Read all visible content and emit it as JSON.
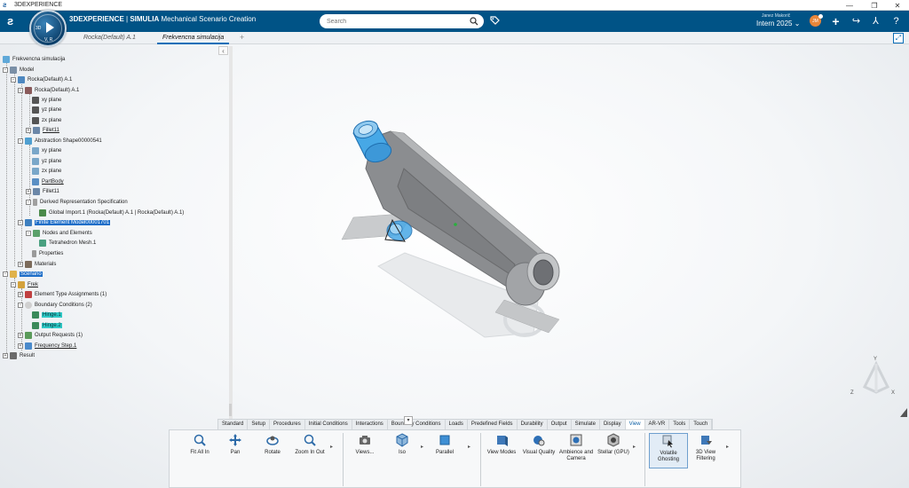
{
  "window": {
    "title": "3DEXPERIENCE",
    "controls": [
      "—",
      "❐",
      "✕"
    ]
  },
  "header": {
    "brand_bold": "3DEXPERIENCE",
    "brand_sep": " | ",
    "brand_product": "SIMULIA",
    "brand_app": " Mechanical Scenario Creation",
    "search_placeholder": "Search",
    "user_name": "Janez Makorič",
    "user_company": "Intern 2025",
    "avatar_initials": "JM",
    "icons": [
      "plus-icon",
      "share-icon",
      "collaborate-icon",
      "help-icon"
    ]
  },
  "compass": {
    "label_3d": "3D",
    "label_v": "V, R"
  },
  "tabs": [
    {
      "label": "Rocka(Default) A.1",
      "active": false
    },
    {
      "label": "Frekvencna simulacija",
      "active": true
    }
  ],
  "tab_add": "+",
  "tree": {
    "root": "Frekvencna simulacija",
    "model": "Model",
    "rocka_default": "Rocka(Default) A.1",
    "rocka_inner": "Rocka(Default) A.1",
    "xy1": "xy plane",
    "yz1": "yz plane",
    "zx1": "zx plane",
    "fillet1": "Fillet11",
    "abstraction": "Abstraction Shape00000541",
    "xy2": "xy plane",
    "yz2": "yz plane",
    "zx2": "zx plane",
    "partbody": "PartBody",
    "fillet2": "Fillet11",
    "derived": "Derived Representation Specification",
    "global_import": "Global Import.1 (Rocka(Default) A.1 | Rocka(Default) A.1)",
    "fem": "Finite Element Model00001701",
    "nodes": "Nodes and Elements",
    "tetra": "Tetrahedron Mesh.1",
    "properties": "Properties",
    "materials": "Materials",
    "scenario": "Scenario",
    "frek": "Frek",
    "eta": "Element Type Assignments (1)",
    "bc": "Boundary Conditions (2)",
    "hinge1": "Hinge.1",
    "hinge2": "Hinge.2",
    "output": "Output Requests (1)",
    "freqstep": "Frequency Step.1",
    "result": "Result"
  },
  "action_tabs": [
    {
      "label": "Standard"
    },
    {
      "label": "Setup"
    },
    {
      "label": "Procedures"
    },
    {
      "label": "Initial Conditions"
    },
    {
      "label": "Interactions"
    },
    {
      "label": "Boundary Conditions"
    },
    {
      "label": "Loads"
    },
    {
      "label": "Predefined Fields"
    },
    {
      "label": "Durability"
    },
    {
      "label": "Output"
    },
    {
      "label": "Simulate"
    },
    {
      "label": "Display"
    },
    {
      "label": "View",
      "active": true
    },
    {
      "label": "AR-VR"
    },
    {
      "label": "Tools"
    },
    {
      "label": "Touch"
    }
  ],
  "actions": {
    "fit": "Fit All In",
    "pan": "Pan",
    "rotate": "Rotate",
    "zoom": "Zoom In Out",
    "views": "Views...",
    "iso": "Iso",
    "parallel": "Parallel",
    "view_modes": "View Modes",
    "visual_quality": "Visual Quality",
    "ambience": "Ambience and Camera",
    "stellar": "Stellar (GPU)",
    "volatile": "Volatile Ghosting",
    "view_filtering": "3D View Filtering"
  },
  "triad": {
    "x": "X",
    "y": "Y",
    "z": "Z"
  },
  "colors": {
    "header": "#005386",
    "selection": "#1e6ec8",
    "highlight": "#2fc9c6",
    "hinge_blue": "#47a8e6",
    "part_gray": "#8b8d90"
  }
}
